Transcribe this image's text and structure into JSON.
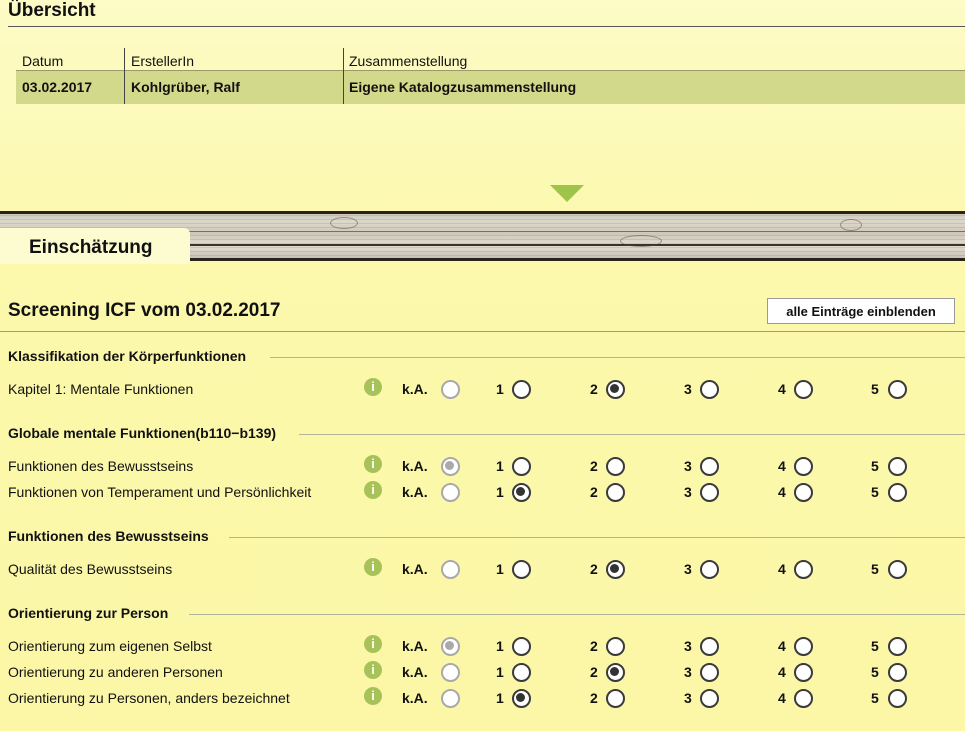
{
  "overview": {
    "title": "Übersicht",
    "columns": [
      "Datum",
      "ErstellerIn",
      "Zusammenstellung"
    ],
    "row": {
      "date": "03.02.2017",
      "author": "Kohlgrüber, Ralf",
      "compilation": "Eigene Katalogzusammenstellung"
    }
  },
  "tab": {
    "label": "Einschätzung"
  },
  "screening": {
    "title": "Screening ICF vom 03.02.2017",
    "show_all_label": "alle Einträge einblenden"
  },
  "scale_labels": [
    "k.A.",
    "1",
    "2",
    "3",
    "4",
    "5"
  ],
  "sections": [
    {
      "title": "Klassifikation der Körperfunktionen",
      "rows": [
        {
          "label": "Kapitel 1: Mentale Funktionen",
          "selected": "2"
        }
      ]
    },
    {
      "title": "Globale mentale Funktionen(b110−b139)",
      "rows": [
        {
          "label": "Funktionen des Bewusstseins",
          "selected": "k.A."
        },
        {
          "label": "Funktionen von Temperament und Persönlichkeit",
          "selected": "1"
        }
      ]
    },
    {
      "title": "Funktionen des Bewusstseins",
      "rows": [
        {
          "label": "Qualität des Bewusstseins",
          "selected": "2"
        }
      ]
    },
    {
      "title": "Orientierung zur Person",
      "rows": [
        {
          "label": "Orientierung zum eigenen Selbst",
          "selected": "k.A."
        },
        {
          "label": "Orientierung zu anderen Personen",
          "selected": "2"
        },
        {
          "label": "Orientierung zu Personen, anders bezeichnet",
          "selected": "1"
        }
      ]
    }
  ],
  "colors": {
    "accent": "#9ec44a",
    "table_row": "#d3d98a",
    "background": "#fcf8ac"
  },
  "icons": {
    "info": "info-icon",
    "collapse": "chevron-down-icon"
  }
}
